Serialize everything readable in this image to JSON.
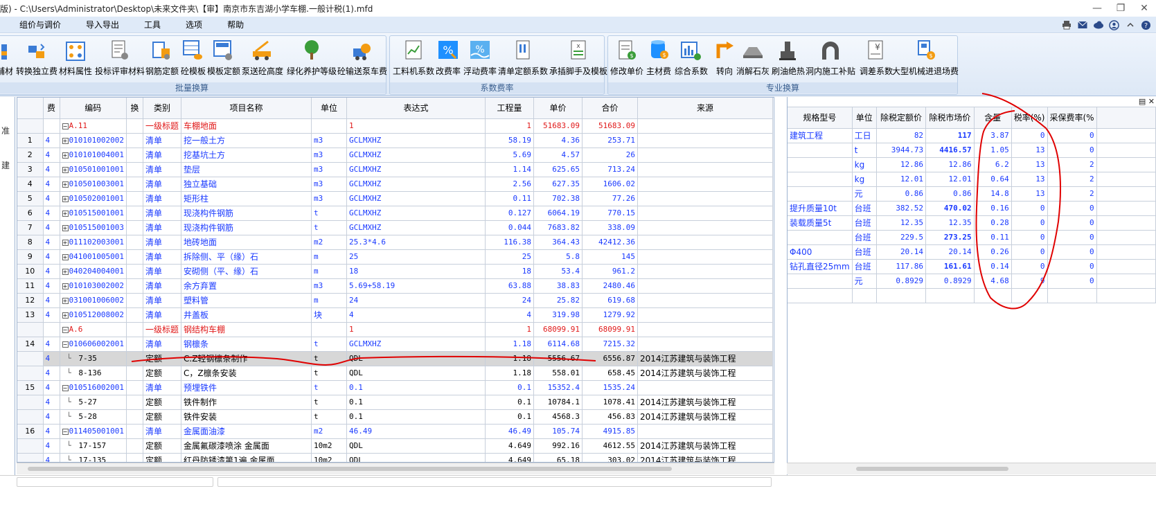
{
  "window": {
    "title": "版) - C:\\Users\\Administrator\\Desktop\\未来文件夹\\【审】南京市东吉湖小学车棚.一般计税(1).mfd"
  },
  "menu": {
    "items": [
      "组价与调价",
      "导入导出",
      "工具",
      "选项",
      "帮助"
    ]
  },
  "ribbon": {
    "group1": {
      "label": "批量换算",
      "buttons": [
        "辅材",
        "转换独立费",
        "材料属性",
        "投标评审材料",
        "钢筋定额",
        "砼模板",
        "模板定额",
        "泵送砼高度",
        "绿化养护等级",
        "砼输送泵车费"
      ]
    },
    "group2": {
      "label": "系数费率",
      "buttons": [
        "工料机系数",
        "改费率",
        "浮动费率",
        "清单定额系数",
        "承插脚手及模板"
      ]
    },
    "group3": {
      "label": "专业换算",
      "buttons": [
        "修改单价",
        "主材费",
        "综合系数",
        "转向",
        "消解石灰",
        "刷油绝热",
        "洞内施工补贴",
        "调差系数",
        "大型机械进退场费"
      ]
    }
  },
  "left_panel": {
    "chars": [
      "准",
      "建"
    ]
  },
  "main_table": {
    "headers": [
      "费",
      "编码",
      "换",
      "类别",
      "项目名称",
      "单位",
      "表达式",
      "工程量",
      "单价",
      "合价",
      "来源"
    ],
    "rows": [
      {
        "rn": "",
        "fee": "",
        "tree": "-",
        "code": "A.11",
        "swap": "",
        "cat": "一级标题",
        "name": "车棚地面",
        "unit": "",
        "expr": "1",
        "qty": "1",
        "price": "51683.09",
        "total": "51683.09",
        "src": "",
        "style": "red"
      },
      {
        "rn": "1",
        "fee": "4",
        "tree": "+",
        "code": "010101002002",
        "swap": "",
        "cat": "清单",
        "name": "挖一般土方",
        "unit": "m3",
        "expr": "GCLMXHZ",
        "qty": "58.19",
        "price": "4.36",
        "total": "253.71",
        "src": "",
        "style": "blue"
      },
      {
        "rn": "2",
        "fee": "4",
        "tree": "+",
        "code": "010101004001",
        "swap": "",
        "cat": "清单",
        "name": "挖基坑土方",
        "unit": "m3",
        "expr": "GCLMXHZ",
        "qty": "5.69",
        "price": "4.57",
        "total": "26",
        "src": "",
        "style": "blue"
      },
      {
        "rn": "3",
        "fee": "4",
        "tree": "+",
        "code": "010501001001",
        "swap": "",
        "cat": "清单",
        "name": "垫层",
        "unit": "m3",
        "expr": "GCLMXHZ",
        "qty": "1.14",
        "price": "625.65",
        "total": "713.24",
        "src": "",
        "style": "blue"
      },
      {
        "rn": "4",
        "fee": "4",
        "tree": "+",
        "code": "010501003001",
        "swap": "",
        "cat": "清单",
        "name": "独立基础",
        "unit": "m3",
        "expr": "GCLMXHZ",
        "qty": "2.56",
        "price": "627.35",
        "total": "1606.02",
        "src": "",
        "style": "blue"
      },
      {
        "rn": "5",
        "fee": "4",
        "tree": "+",
        "code": "010502001001",
        "swap": "",
        "cat": "清单",
        "name": "矩形柱",
        "unit": "m3",
        "expr": "GCLMXHZ",
        "qty": "0.11",
        "price": "702.38",
        "total": "77.26",
        "src": "",
        "style": "blue"
      },
      {
        "rn": "6",
        "fee": "4",
        "tree": "+",
        "code": "010515001001",
        "swap": "",
        "cat": "清单",
        "name": "现浇构件钢筋",
        "unit": "t",
        "expr": "GCLMXHZ",
        "qty": "0.127",
        "price": "6064.19",
        "total": "770.15",
        "src": "",
        "style": "blue"
      },
      {
        "rn": "7",
        "fee": "4",
        "tree": "+",
        "code": "010515001003",
        "swap": "",
        "cat": "清单",
        "name": "现浇构件钢筋",
        "unit": "t",
        "expr": "GCLMXHZ",
        "qty": "0.044",
        "price": "7683.82",
        "total": "338.09",
        "src": "",
        "style": "blue"
      },
      {
        "rn": "8",
        "fee": "4",
        "tree": "+",
        "code": "011102003001",
        "swap": "",
        "cat": "清单",
        "name": "地砖地面",
        "unit": "m2",
        "expr": "25.3*4.6",
        "qty": "116.38",
        "price": "364.43",
        "total": "42412.36",
        "src": "",
        "style": "blue"
      },
      {
        "rn": "9",
        "fee": "4",
        "tree": "+",
        "code": "041001005001",
        "swap": "",
        "cat": "清单",
        "name": "拆除侧、平（缘）石",
        "unit": "m",
        "expr": "25",
        "qty": "25",
        "price": "5.8",
        "total": "145",
        "src": "",
        "style": "blue"
      },
      {
        "rn": "10",
        "fee": "4",
        "tree": "+",
        "code": "040204004001",
        "swap": "",
        "cat": "清单",
        "name": "安砌侧（平、缘）石",
        "unit": "m",
        "expr": "18",
        "qty": "18",
        "price": "53.4",
        "total": "961.2",
        "src": "",
        "style": "blue"
      },
      {
        "rn": "11",
        "fee": "4",
        "tree": "+",
        "code": "010103002002",
        "swap": "",
        "cat": "清单",
        "name": "余方弃置",
        "unit": "m3",
        "expr": "5.69+58.19",
        "qty": "63.88",
        "price": "38.83",
        "total": "2480.46",
        "src": "",
        "style": "blue"
      },
      {
        "rn": "12",
        "fee": "4",
        "tree": "+",
        "code": "031001006002",
        "swap": "",
        "cat": "清单",
        "name": "塑料管",
        "unit": "m",
        "expr": "24",
        "qty": "24",
        "price": "25.82",
        "total": "619.68",
        "src": "",
        "style": "blue"
      },
      {
        "rn": "13",
        "fee": "4",
        "tree": "+",
        "code": "010512008002",
        "swap": "",
        "cat": "清单",
        "name": "井盖板",
        "unit": "块",
        "expr": "4",
        "qty": "4",
        "price": "319.98",
        "total": "1279.92",
        "src": "",
        "style": "blue"
      },
      {
        "rn": "",
        "fee": "",
        "tree": "-",
        "code": "A.6",
        "swap": "",
        "cat": "一级标题",
        "name": "钢结构车棚",
        "unit": "",
        "expr": "1",
        "qty": "1",
        "price": "68099.91",
        "total": "68099.91",
        "src": "",
        "style": "red"
      },
      {
        "rn": "14",
        "fee": "4",
        "tree": "-",
        "code": "010606002001",
        "swap": "",
        "cat": "清单",
        "name": "钢檩条",
        "unit": "t",
        "expr": "GCLMXHZ",
        "qty": "1.18",
        "price": "6114.68",
        "total": "7215.32",
        "src": "",
        "style": "blue"
      },
      {
        "rn": "",
        "fee": "4",
        "tree": "leaf",
        "code": "7-35",
        "swap": "",
        "cat": "定额",
        "name": "C.Z轻钢檩条制作",
        "unit": "t",
        "expr": "QDL",
        "qty": "1.18",
        "price": "5556.67",
        "total": "6556.87",
        "src": "2014江苏建筑与装饰工程",
        "style": "sel"
      },
      {
        "rn": "",
        "fee": "4",
        "tree": "leaf",
        "code": "8-136",
        "swap": "",
        "cat": "定额",
        "name": "C，Z檩条安装",
        "unit": "t",
        "expr": "QDL",
        "qty": "1.18",
        "price": "558.01",
        "total": "658.45",
        "src": "2014江苏建筑与装饰工程",
        "style": "blk"
      },
      {
        "rn": "15",
        "fee": "4",
        "tree": "-",
        "code": "010516002001",
        "swap": "",
        "cat": "清单",
        "name": "预埋铁件",
        "unit": "t",
        "expr": "0.1",
        "qty": "0.1",
        "price": "15352.4",
        "total": "1535.24",
        "src": "",
        "style": "blue"
      },
      {
        "rn": "",
        "fee": "4",
        "tree": "leaf",
        "code": "5-27",
        "swap": "",
        "cat": "定额",
        "name": "铁件制作",
        "unit": "t",
        "expr": "0.1",
        "qty": "0.1",
        "price": "10784.1",
        "total": "1078.41",
        "src": "2014江苏建筑与装饰工程",
        "style": "blk"
      },
      {
        "rn": "",
        "fee": "4",
        "tree": "leaf",
        "code": "5-28",
        "swap": "",
        "cat": "定额",
        "name": "铁件安装",
        "unit": "t",
        "expr": "0.1",
        "qty": "0.1",
        "price": "4568.3",
        "total": "456.83",
        "src": "2014江苏建筑与装饰工程",
        "style": "blk"
      },
      {
        "rn": "16",
        "fee": "4",
        "tree": "-",
        "code": "011405001001",
        "swap": "",
        "cat": "清单",
        "name": "金属面油漆",
        "unit": "m2",
        "expr": "46.49",
        "qty": "46.49",
        "price": "105.74",
        "total": "4915.85",
        "src": "",
        "style": "blue"
      },
      {
        "rn": "",
        "fee": "4",
        "tree": "leaf",
        "code": "17-157",
        "swap": "",
        "cat": "定额",
        "name": "金属氟碳漆喷涂 金属面",
        "unit": "10m2",
        "expr": "QDL",
        "qty": "4.649",
        "price": "992.16",
        "total": "4612.55",
        "src": "2014江苏建筑与装饰工程",
        "style": "blk"
      },
      {
        "rn": "",
        "fee": "4",
        "tree": "leaf",
        "code": "17-135",
        "swap": "",
        "cat": "定额",
        "name": "红丹防锈漆第1遍 金属面",
        "unit": "10m2",
        "expr": "QDL",
        "qty": "4.649",
        "price": "65.18",
        "total": "303.02",
        "src": "2014江苏建筑与装饰工程",
        "style": "blk"
      }
    ]
  },
  "detail_table": {
    "headers": [
      "规格型号",
      "单位",
      "除税定额价",
      "除税市场价",
      "含量",
      "税率(%)",
      "采保费率(%"
    ],
    "rows": [
      {
        "spec": "建筑工程",
        "unit": "工日",
        "base": "82",
        "market": "117",
        "qty": "3.87",
        "tax": "0",
        "cb": "0",
        "bold": true
      },
      {
        "spec": "",
        "unit": "t",
        "base": "3944.73",
        "market": "4416.57",
        "qty": "1.05",
        "tax": "13",
        "cb": "0",
        "bold": true
      },
      {
        "spec": "",
        "unit": "kg",
        "base": "12.86",
        "market": "12.86",
        "qty": "6.2",
        "tax": "13",
        "cb": "2",
        "bold": false
      },
      {
        "spec": "",
        "unit": "kg",
        "base": "12.01",
        "market": "12.01",
        "qty": "0.64",
        "tax": "13",
        "cb": "2",
        "bold": false
      },
      {
        "spec": "",
        "unit": "元",
        "base": "0.86",
        "market": "0.86",
        "qty": "14.8",
        "tax": "13",
        "cb": "2",
        "bold": false
      },
      {
        "spec": "提升质量10t",
        "unit": "台班",
        "base": "382.52",
        "market": "470.02",
        "qty": "0.16",
        "tax": "0",
        "cb": "0",
        "bold": true
      },
      {
        "spec": "装载质量5t",
        "unit": "台班",
        "base": "12.35",
        "market": "12.35",
        "qty": "0.28",
        "tax": "0",
        "cb": "0",
        "bold": false
      },
      {
        "spec": "",
        "unit": "台班",
        "base": "229.5",
        "market": "273.25",
        "qty": "0.11",
        "tax": "0",
        "cb": "0",
        "bold": true
      },
      {
        "spec": "Φ400",
        "unit": "台班",
        "base": "20.14",
        "market": "20.14",
        "qty": "0.26",
        "tax": "0",
        "cb": "0",
        "bold": false
      },
      {
        "spec": "钻孔直径25mm",
        "unit": "台班",
        "base": "117.86",
        "market": "161.61",
        "qty": "0.14",
        "tax": "0",
        "cb": "0",
        "bold": true
      },
      {
        "spec": "",
        "unit": "元",
        "base": "0.8929",
        "market": "0.8929",
        "qty": "4.68",
        "tax": "9",
        "cb": "0",
        "bold": false
      }
    ]
  },
  "colors": {
    "blue_text": "#1a3aff",
    "red_text": "#e01818",
    "selected_row": "#d7d7d7",
    "annotation_red": "#e00000",
    "menubar": "#dfeaf8"
  }
}
